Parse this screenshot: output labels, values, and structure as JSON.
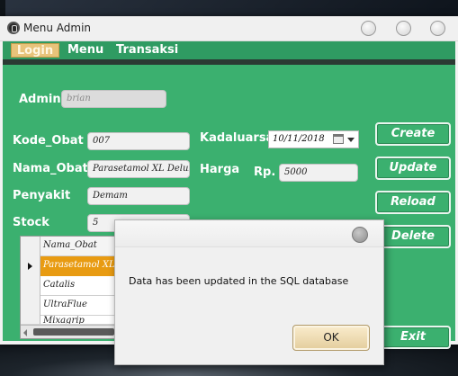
{
  "window": {
    "title": "Menu Admin"
  },
  "menubar": {
    "items": [
      "Login",
      "Menu",
      "Transaksi"
    ]
  },
  "form": {
    "admin_label": "Admin",
    "admin_value": "brian",
    "kode_label": "Kode_Obat",
    "kode_value": "007",
    "nama_label": "Nama_Obat",
    "nama_value": "Parasetamol XL Deluxe",
    "penyakit_label": "Penyakit",
    "penyakit_value": "Demam",
    "stock_label": "Stock",
    "stock_value": "5",
    "kadaluarsa_label": "Kadaluarsa",
    "kadaluarsa_value": "10/11/2018",
    "harga_label": "Harga",
    "currency_label": "Rp.",
    "harga_value": "5000"
  },
  "buttons": {
    "create": "Create",
    "update": "Update",
    "reload": "Reload",
    "delete": "Delete",
    "exit": "Exit"
  },
  "table": {
    "header": "Nama_Obat",
    "rows": [
      "Parasetamol XL Deluxe",
      "Catalis",
      "UltraFlue",
      "Mixagrip"
    ]
  },
  "dialog": {
    "message": "Data has been updated in the SQL database",
    "ok_label": "OK"
  },
  "colors": {
    "form_bg": "#3bb06f",
    "menubar_bg": "#2f9b62",
    "selected_row": "#e89b12",
    "active_menu": "#e8c37a"
  }
}
